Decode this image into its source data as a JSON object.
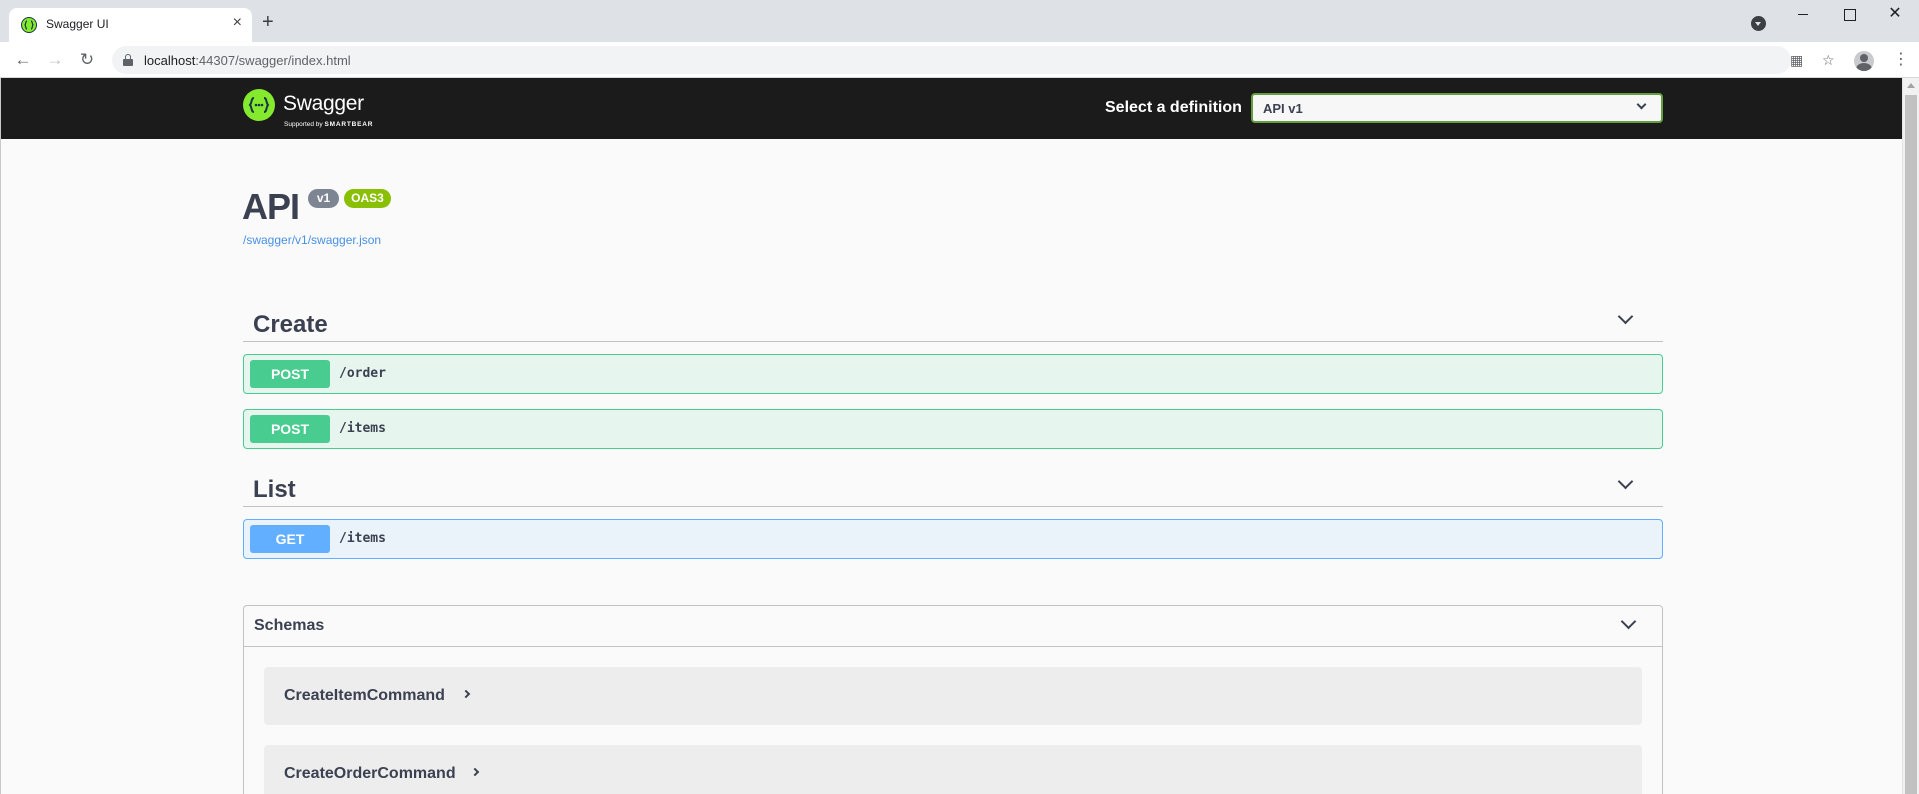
{
  "browser": {
    "tab_title": "Swagger UI",
    "tab_close": "×",
    "new_tab": "+",
    "url_host": "localhost",
    "url_rest": ":44307/swagger/index.html",
    "close_window": "✕"
  },
  "topbar": {
    "logo_text": "Swagger",
    "logo_sub_prefix": "Supported by",
    "logo_sub_brand": "SMARTBEAR",
    "select_label": "Select a definition",
    "selected_definition": "API v1"
  },
  "info": {
    "title": "API",
    "version_badge": "v1",
    "oas_badge": "OAS3",
    "spec_url": "/swagger/v1/swagger.json"
  },
  "tags": [
    {
      "name": "Create",
      "operations": [
        {
          "method": "POST",
          "path": "/order"
        },
        {
          "method": "POST",
          "path": "/items"
        }
      ]
    },
    {
      "name": "List",
      "operations": [
        {
          "method": "GET",
          "path": "/items"
        }
      ]
    }
  ],
  "schemas": {
    "title": "Schemas",
    "models": [
      "CreateItemCommand",
      "CreateOrderCommand"
    ]
  },
  "colors": {
    "post": "#49cc90",
    "get": "#61affe",
    "brand": "#85ea2d",
    "oas_badge": "#89bf04",
    "topbar": "#1b1b1b"
  }
}
